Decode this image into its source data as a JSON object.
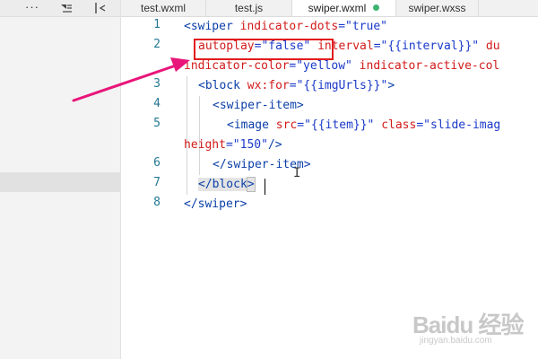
{
  "sidebar": {
    "icons": [
      "more-icon",
      "collapse-all-icon",
      "split-editor-icon"
    ],
    "more_glyph": "···"
  },
  "tabs": [
    {
      "label": "test.wxml",
      "active": false,
      "modified": false
    },
    {
      "label": "test.js",
      "active": false,
      "modified": false
    },
    {
      "label": "swiper.wxml",
      "active": true,
      "modified": true
    },
    {
      "label": "swiper.wxss",
      "active": false,
      "modified": false
    }
  ],
  "editor": {
    "line_numbers": [
      "1",
      "2",
      "3",
      "4",
      "5",
      "6",
      "7",
      "8"
    ],
    "code": {
      "l1": {
        "tag_open": "<swiper",
        "a1": " indicator-dots",
        "v1": "=\"true\""
      },
      "l2": {
        "a1": "autoplay",
        "v1": "=\"false\"",
        "a2": " interval",
        "v2": "=\"{{interval}}\"",
        "a3": " du"
      },
      "l2b": {
        "a1": "indicator-color",
        "v1": "=\"yellow\"",
        "a2": " indicator-active-col"
      },
      "l3": {
        "tag_open": "<block",
        "a1": " wx:for",
        "v1": "=\"{{imgUrls}}\"",
        "tag_close": ">"
      },
      "l4": {
        "tag": "<swiper-item>"
      },
      "l5": {
        "tag_open": "<image",
        "a1": " src",
        "v1": "=\"{{item}}\"",
        "a2": " class",
        "v2": "=\"slide-imag"
      },
      "l5b": {
        "a1": "height",
        "v1": "=\"150\"",
        "tag_close": "/>"
      },
      "l6": {
        "tag": "</swiper-item>"
      },
      "l7": {
        "tag_open": "</block",
        "tag_close": ">"
      },
      "l8": {
        "tag": "</swiper>"
      }
    }
  },
  "colors": {
    "tag": "#0b3fa8",
    "attribute": "#d21a1a",
    "value": "#1a39c9",
    "line_number": "#237893",
    "highlight_box": "#e21b1b",
    "arrow": "#e8157a"
  },
  "watermark": {
    "main": "Baidu 经验",
    "sub": "jingyan.baidu.com"
  }
}
